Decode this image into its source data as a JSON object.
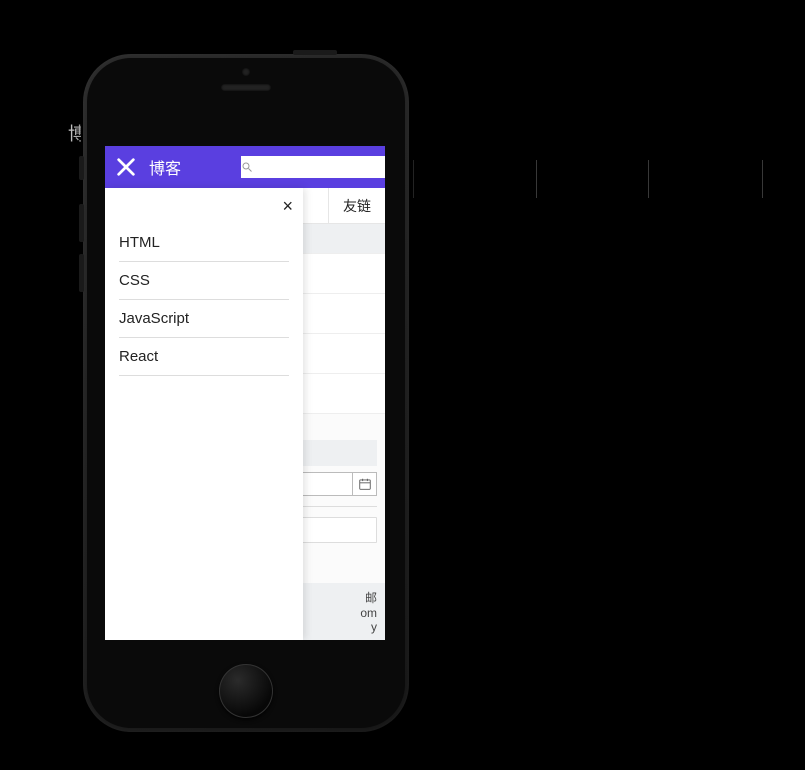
{
  "bg_text": "博",
  "topbar": {
    "title": "博客",
    "search_placeholder": ""
  },
  "panel": {
    "close_glyph": "×",
    "items": [
      {
        "label": "HTML"
      },
      {
        "label": "CSS"
      },
      {
        "label": "JavaScript"
      },
      {
        "label": "React"
      }
    ]
  },
  "navrow": {
    "right_item": "友链"
  },
  "footer": {
    "line1": "邮",
    "line2": "om",
    "line3": "y"
  }
}
